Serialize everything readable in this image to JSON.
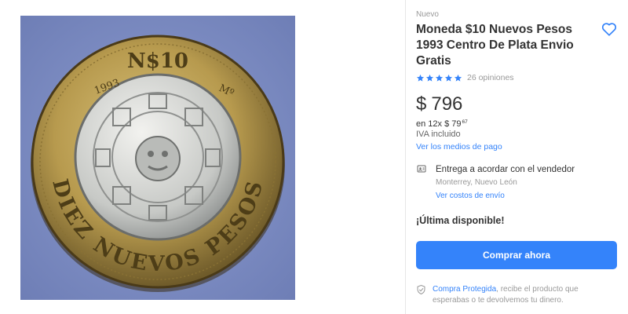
{
  "product": {
    "image": {
      "alt": "Moneda $10 Nuevos Pesos 1993",
      "coin_text": {
        "denomination": "N$10",
        "year_left": "1993",
        "mint_mark": "Mº",
        "ring_text": "DIEZ NUEVOS PESOS"
      },
      "colors": {
        "background": "#7d8ec2",
        "ring": "#b79a4e",
        "center": "#c7c9c6"
      }
    },
    "condition": "Nuevo",
    "title": "Moneda $10 Nuevos Pesos 1993 Centro De Plata Envio Gratis",
    "favorite_icon": "heart-outline-icon",
    "rating": {
      "stars": 5,
      "max_stars": 5,
      "reviews_label": "26 opiniones"
    },
    "price": {
      "currency": "$",
      "amount": "796"
    },
    "installments": {
      "text": "en 12x $ 79",
      "cents": "67"
    },
    "tax_label": "IVA incluido",
    "payment_link": "Ver los medios de pago",
    "shipping": {
      "icon": "id-card-icon",
      "title": "Entrega a acordar con el vendedor",
      "location": "Monterrey, Nuevo León",
      "link": "Ver costos de envío"
    },
    "stock_label": "¡Última disponible!",
    "buy_button": "Comprar ahora",
    "protection": {
      "icon": "shield-check-icon",
      "link": "Compra Protegida",
      "text": ", recibe el producto que esperabas o te devolvemos tu dinero."
    }
  },
  "colors": {
    "accent": "#3483fa",
    "text": "#333333",
    "muted": "#999999"
  }
}
